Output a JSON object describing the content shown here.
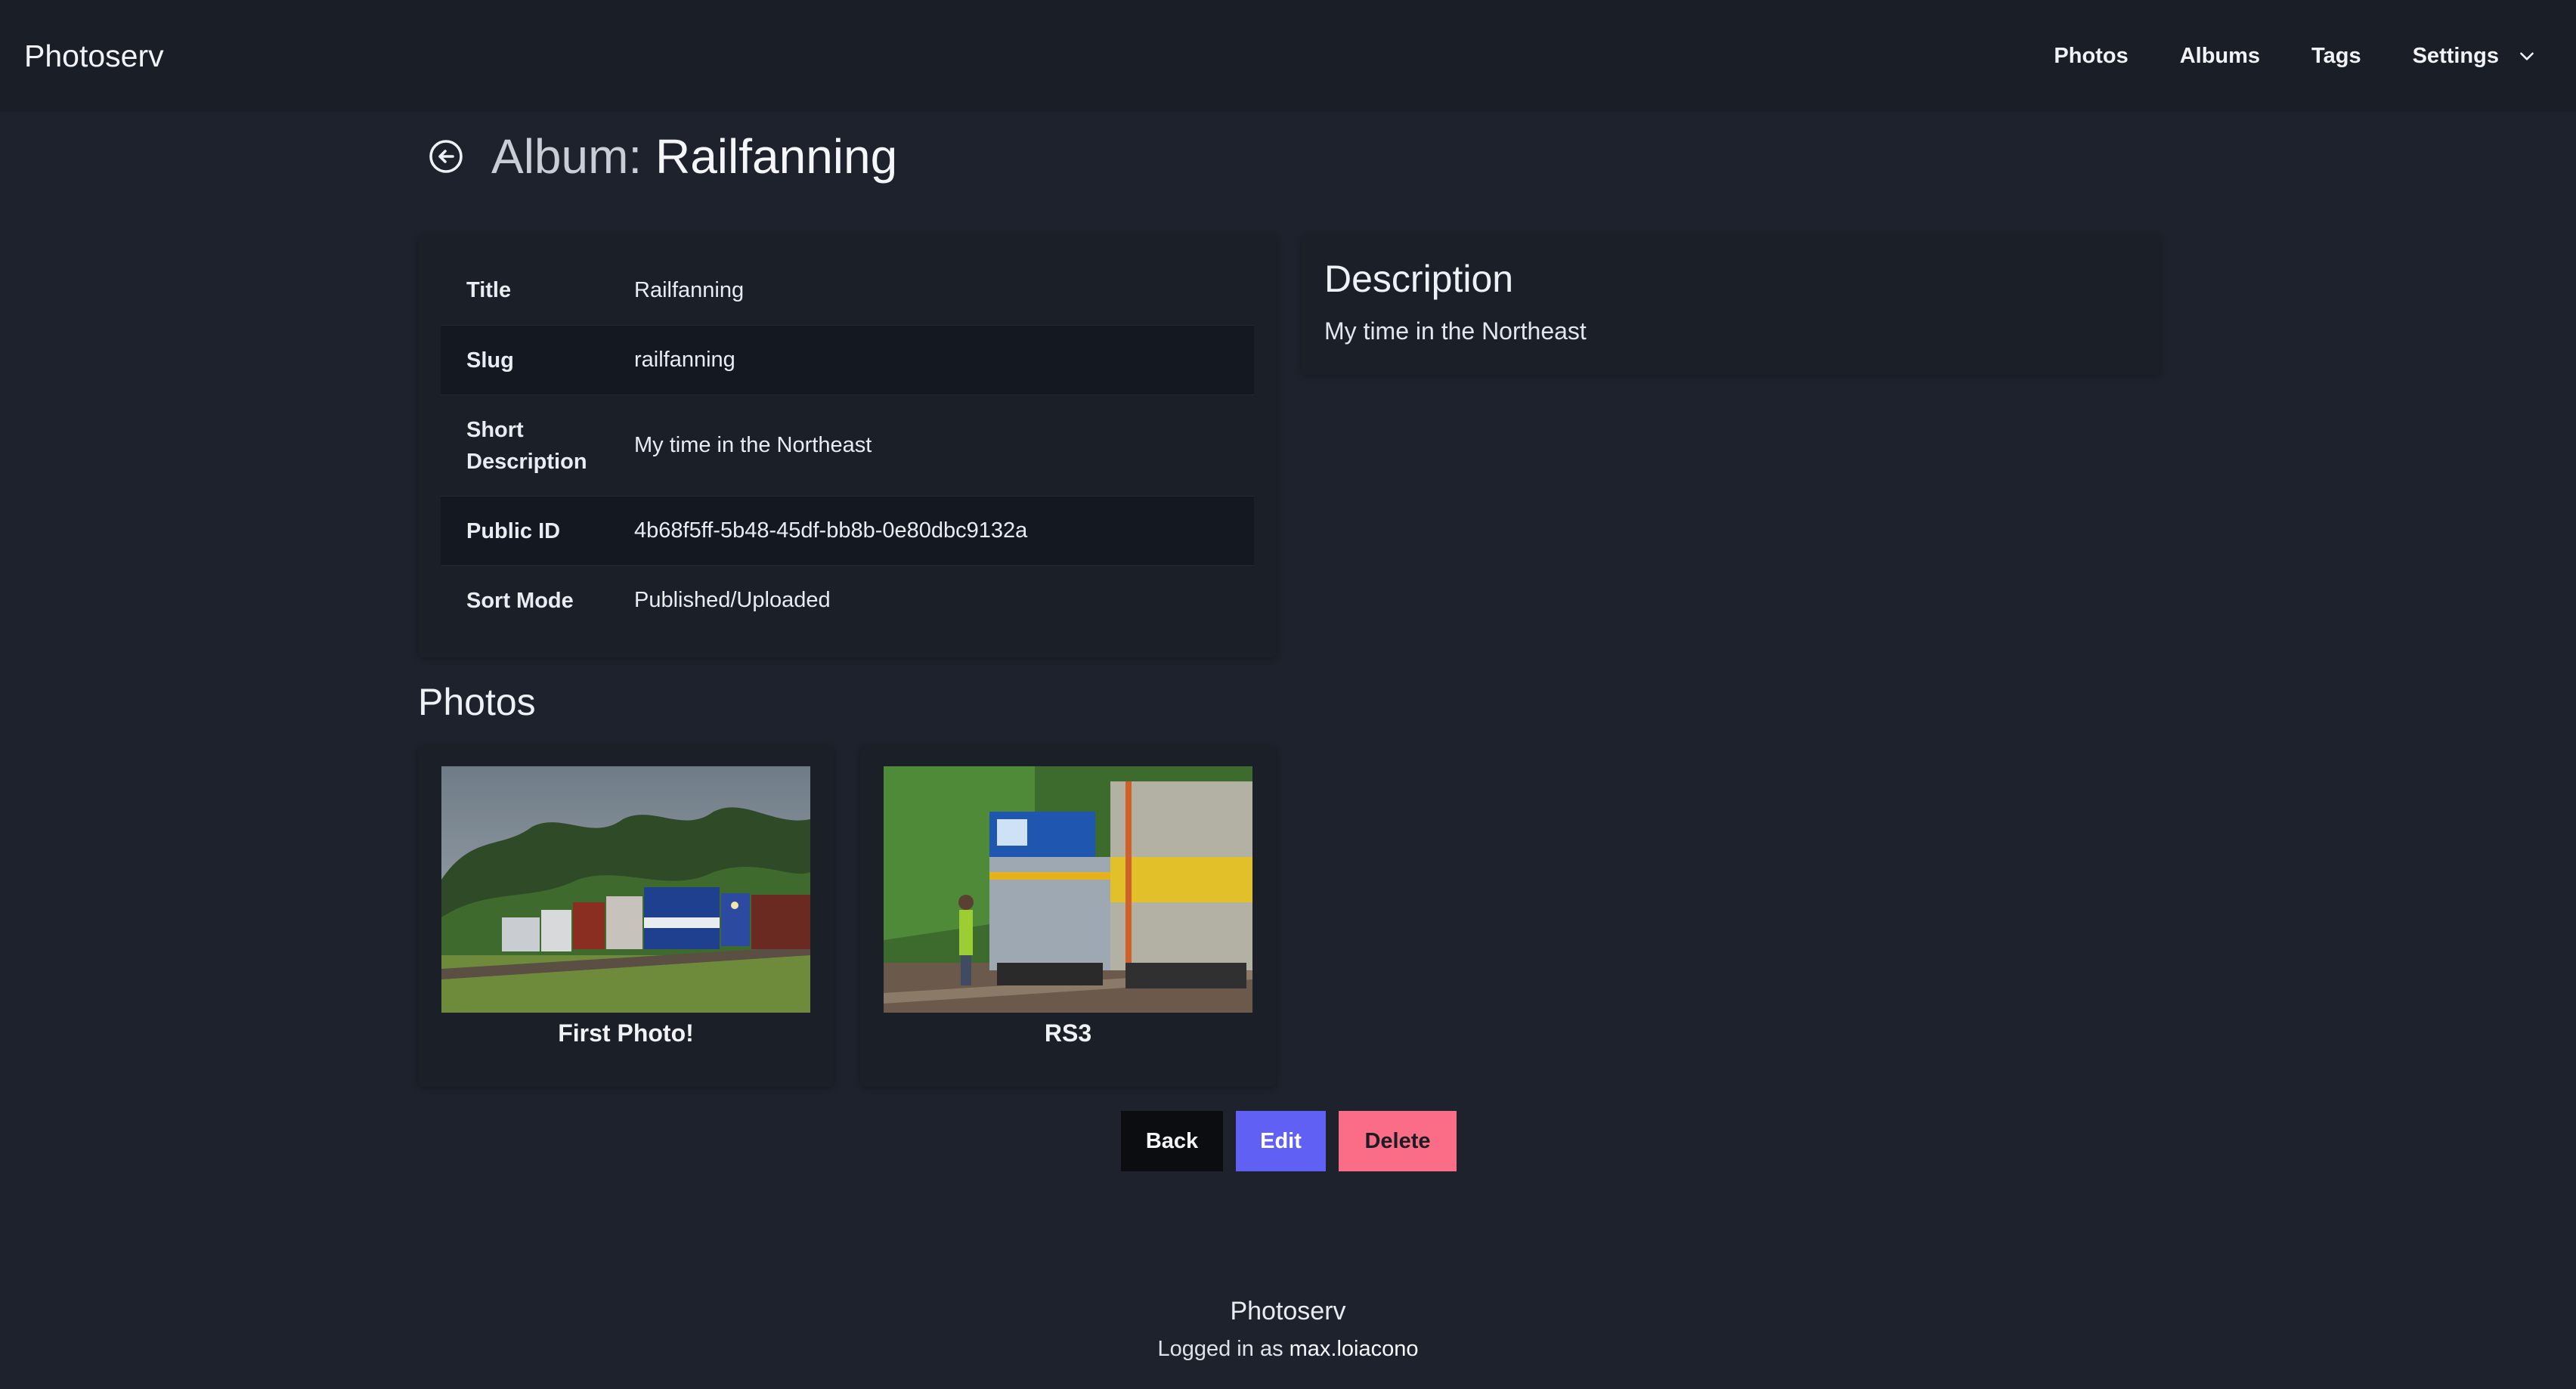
{
  "app": {
    "brand": "Photoserv"
  },
  "nav": {
    "items": [
      {
        "label": "Photos"
      },
      {
        "label": "Albums"
      },
      {
        "label": "Tags"
      },
      {
        "label": "Settings"
      }
    ]
  },
  "page": {
    "title_prefix": "Album: ",
    "title_name": "Railfanning"
  },
  "details": {
    "rows": [
      {
        "label": "Title",
        "value": "Railfanning"
      },
      {
        "label": "Slug",
        "value": "railfanning"
      },
      {
        "label": "Short Description",
        "value": "My time in the Northeast"
      },
      {
        "label": "Public ID",
        "value": "4b68f5ff-5b48-45df-bb8b-0e80dbc9132a"
      },
      {
        "label": "Sort Mode",
        "value": "Published/Uploaded"
      }
    ]
  },
  "description": {
    "heading": "Description",
    "text": "My time in the Northeast"
  },
  "photos": {
    "heading": "Photos",
    "items": [
      {
        "caption": "First Photo!"
      },
      {
        "caption": "RS3"
      }
    ]
  },
  "actions": {
    "back_label": "Back",
    "edit_label": "Edit",
    "delete_label": "Delete"
  },
  "footer": {
    "brand": "Photoserv",
    "logged_in_prefix": "Logged in as ",
    "username": "max.loiacono"
  },
  "colors": {
    "background": "#1d222c",
    "navbar": "#191e27",
    "edit": "#6160f4",
    "delete": "#fb6d86",
    "back": "#0b0d11"
  }
}
